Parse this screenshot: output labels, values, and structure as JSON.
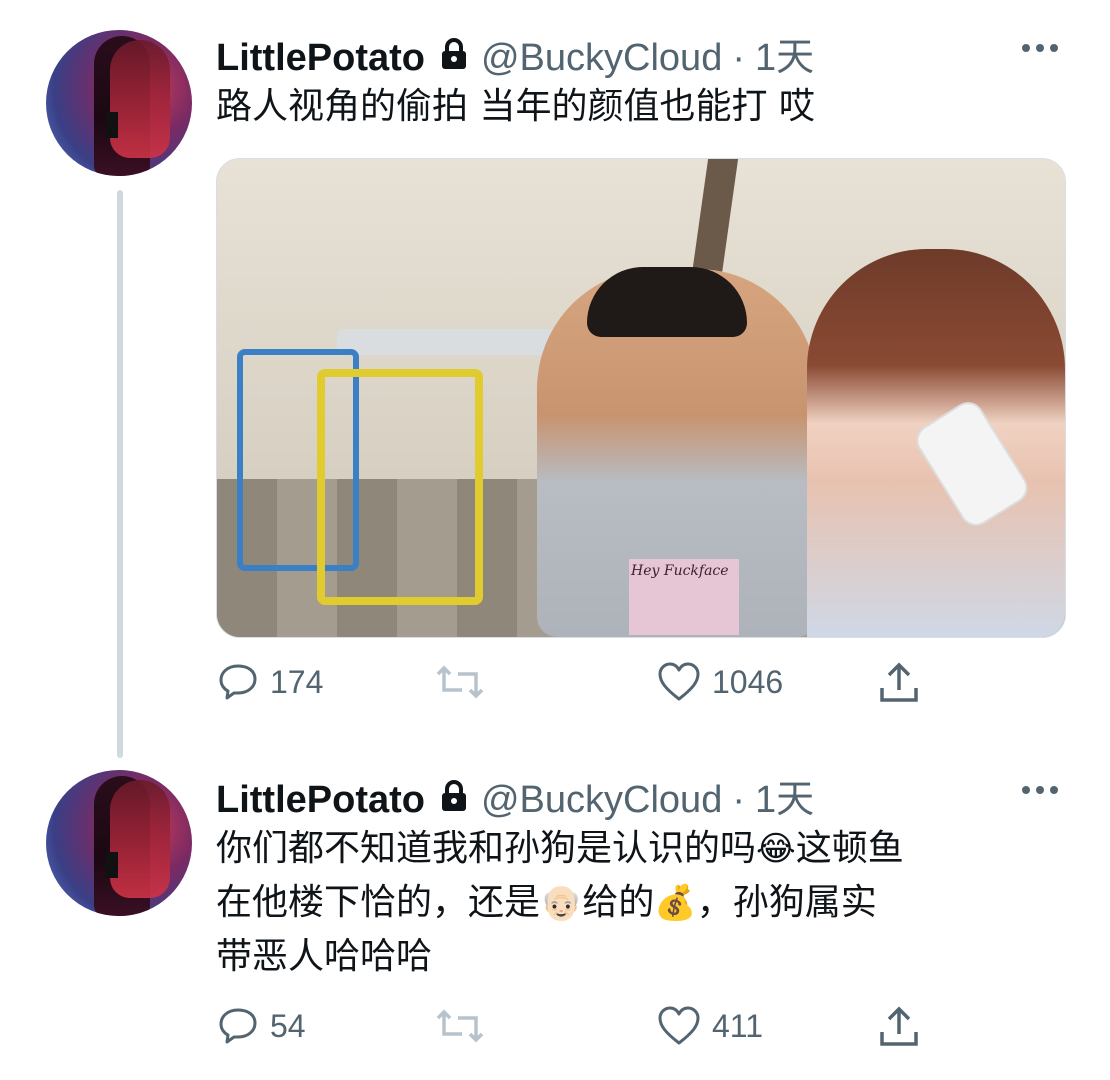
{
  "tweets": [
    {
      "author": {
        "name": "LittlePotato",
        "handle": "@BuckyCloud",
        "time": "1天",
        "separator": "·"
      },
      "text_lines": [
        "路人视角的偷拍 当年的颜值也能打 哎"
      ],
      "media": {
        "shirt_text": "Hey Fuckface"
      },
      "actions": {
        "reply_count": "174",
        "retweet_count": "",
        "like_count": "1046"
      }
    },
    {
      "author": {
        "name": "LittlePotato",
        "handle": "@BuckyCloud",
        "time": "1天",
        "separator": "·"
      },
      "text_lines": [
        {
          "a": "你们都不知道我和孙狗是认识的吗",
          "emoji1": "😂",
          "b": "这顿鱼"
        },
        {
          "a": "在他楼下恰的，还是",
          "emoji1": "👴🏻",
          "b": "给的",
          "emoji2": "💰",
          "c": "，孙狗属实"
        },
        {
          "a": "带恶人哈哈哈"
        }
      ],
      "actions": {
        "reply_count": "54",
        "retweet_count": "",
        "like_count": "411"
      }
    }
  ],
  "icons": {
    "lock": "lock-icon",
    "more": "more-horizontal-icon",
    "reply": "reply-icon",
    "retweet": "retweet-icon",
    "like": "heart-icon",
    "share": "share-icon"
  },
  "colors": {
    "text_primary": "#0f1419",
    "text_secondary": "#536471",
    "thread_line": "#cfd9de"
  }
}
